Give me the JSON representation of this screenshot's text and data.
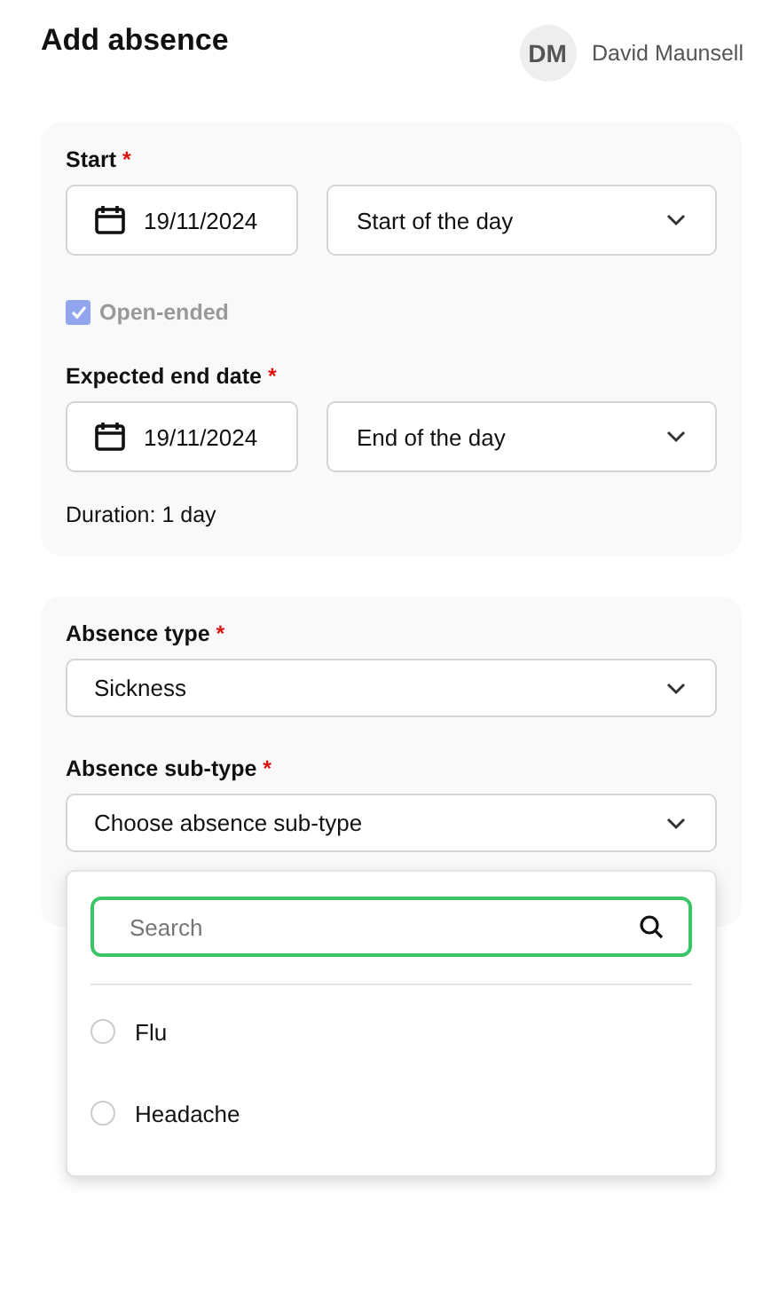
{
  "header": {
    "title": "Add absence",
    "user": {
      "initials": "DM",
      "name": "David Maunsell"
    }
  },
  "dates": {
    "start": {
      "label": "Start",
      "marker": "*",
      "date": "19/11/2024",
      "part": "Start of the day"
    },
    "open_ended": {
      "label": "Open-ended",
      "checked": true,
      "disabled": true
    },
    "end": {
      "label": "Expected end date",
      "marker": "*",
      "date": "19/11/2024",
      "part": "End of the day"
    },
    "duration": "Duration: 1 day"
  },
  "type": {
    "absence_type": {
      "label": "Absence type",
      "marker": "*",
      "value": "Sickness"
    },
    "sub_type": {
      "label": "Absence sub-type",
      "marker": "*",
      "placeholder": "Choose absence sub-type"
    }
  },
  "dropdown": {
    "search": {
      "placeholder": "Search"
    },
    "options": [
      {
        "label": "Flu",
        "selected": false
      },
      {
        "label": "Headache",
        "selected": false
      }
    ]
  }
}
